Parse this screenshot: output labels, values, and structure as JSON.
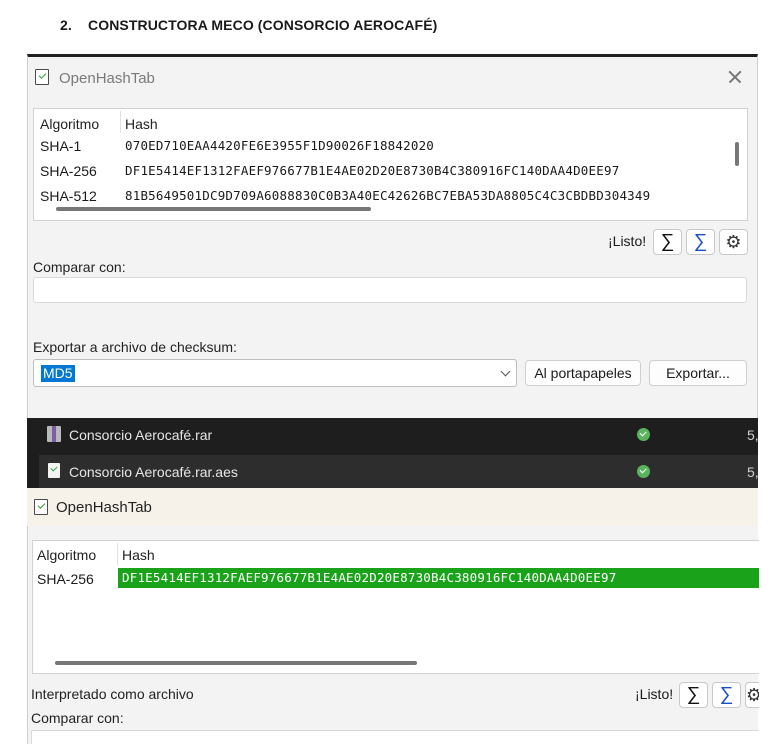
{
  "heading": {
    "number": "2.",
    "text": "CONSTRUCTORA MECO (CONSORCIO AEROCAFÉ)"
  },
  "window1": {
    "title": "OpenHashTab",
    "columns": {
      "algorithm": "Algoritmo",
      "hash": "Hash"
    },
    "rows": [
      {
        "algorithm": "SHA-1",
        "hash": "070ED710EAA4420FE6E3955F1D90026F18842020"
      },
      {
        "algorithm": "SHA-256",
        "hash": "DF1E5414EF1312FAEF976677B1E4AE02D20E8730B4C380916FC140DAA4D0EE97"
      },
      {
        "algorithm": "SHA-512",
        "hash": "81B5649501DC9D709A6088830C0B3A40EC42626BC7EBA53DA8805C4C3CBDBD304349"
      }
    ],
    "status": "¡Listo!",
    "compare_label": "Comparar con:",
    "compare_value": "",
    "export_label": "Exportar a archivo de checksum:",
    "export_selected": "MD5",
    "clipboard_button": "Al portapapeles",
    "export_button": "Exportar...",
    "icons": [
      "sum-icon",
      "sum-verify-icon",
      "gear-icon"
    ]
  },
  "file_list": [
    {
      "name": "Consorcio Aerocafé.rar",
      "status": "ok",
      "cut_text": "5,"
    },
    {
      "name": "Consorcio Aerocafé.rar.aes",
      "status": "ok",
      "cut_text": "5,"
    }
  ],
  "window2": {
    "title": "OpenHashTab",
    "columns": {
      "algorithm": "Algoritmo",
      "hash": "Hash"
    },
    "rows": [
      {
        "algorithm": "SHA-256",
        "hash": "DF1E5414EF1312FAEF976677B1E4AE02D20E8730B4C380916FC140DAA4D0EE97",
        "match_color": "#1aa31a"
      }
    ],
    "interpreted": "Interpretado como archivo",
    "status": "¡Listo!",
    "compare_label": "Comparar con:"
  },
  "colors": {
    "accent": "#0078d4",
    "match": "#1aa31a",
    "dark_bg": "#1e1e1e",
    "selected_row": "#2d2d2d"
  }
}
